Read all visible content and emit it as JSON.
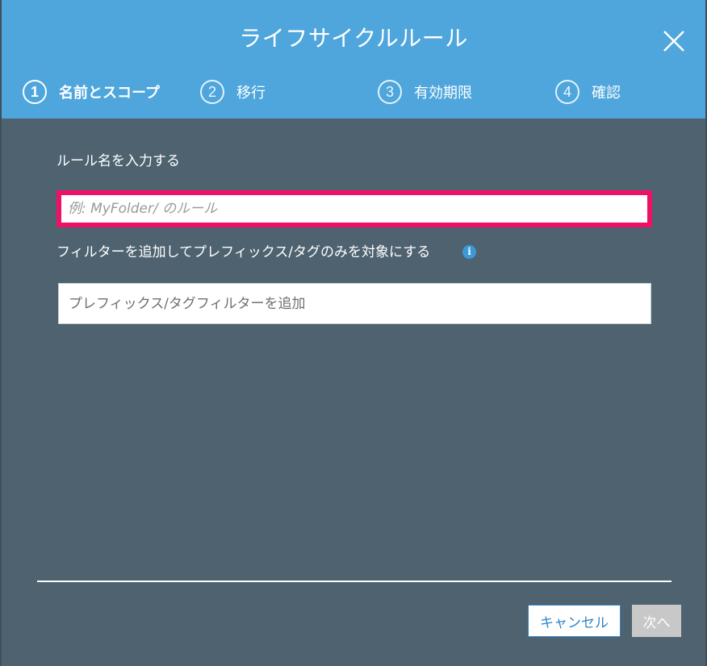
{
  "dialog": {
    "title": "ライフサイクルルール",
    "close_icon": "close-icon"
  },
  "steps": [
    {
      "number": "1",
      "label": "名前とスコープ",
      "active": true
    },
    {
      "number": "2",
      "label": "移行",
      "active": false
    },
    {
      "number": "3",
      "label": "有効期限",
      "active": false
    },
    {
      "number": "4",
      "label": "確認",
      "active": false
    }
  ],
  "form": {
    "rule_name_label": "ルール名を入力する",
    "rule_name_value": "",
    "rule_name_placeholder": "例: MyFolder/ のルール",
    "filter_label": "フィルターを追加してプレフィックス/タグのみを対象にする",
    "filter_info_icon": "info-icon",
    "filter_value": "",
    "filter_placeholder": "プレフィックス/タグフィルターを追加"
  },
  "footer": {
    "cancel_label": "キャンセル",
    "next_label": "次へ"
  },
  "colors": {
    "header": "#4ea6dc",
    "body": "#4e6270",
    "highlight": "#ee1166",
    "button_primary": "#2f86c8",
    "button_disabled": "#c8c8c8"
  }
}
